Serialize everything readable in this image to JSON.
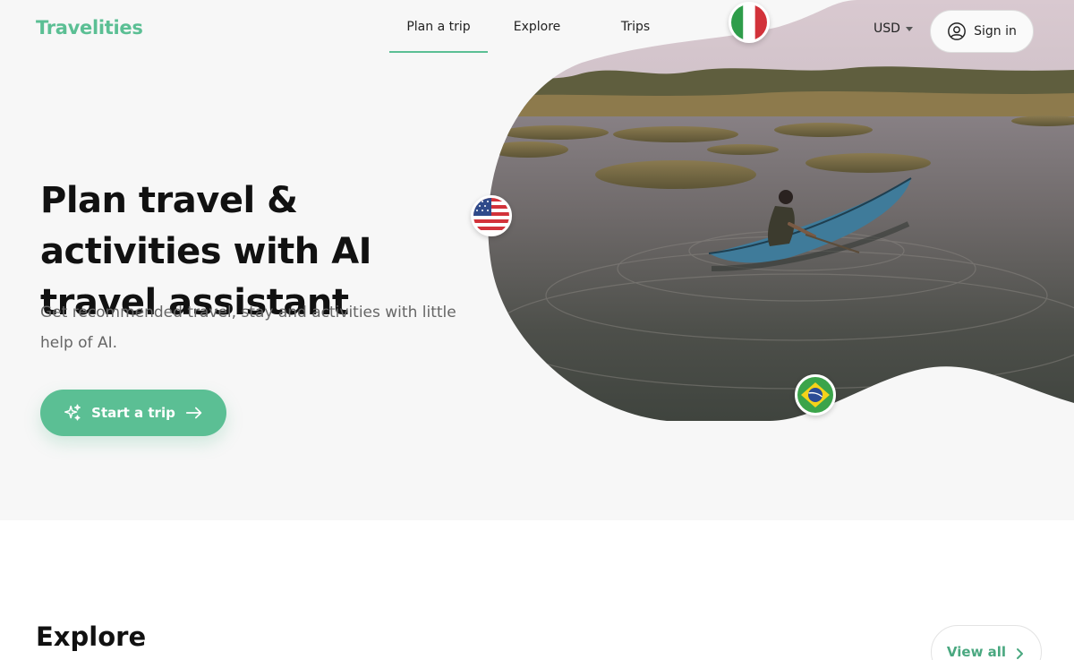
{
  "header": {
    "logo": "Travelities",
    "nav": [
      {
        "label": "Plan a trip",
        "active": true
      },
      {
        "label": "Explore",
        "active": false
      },
      {
        "label": "Trips",
        "active": false
      }
    ],
    "currency": "USD",
    "signin_label": "Sign in"
  },
  "hero": {
    "title": "Plan travel & activities with AI travel assistant",
    "subtitle": "Get recommended travel, stay and activities with little help of AI.",
    "cta_label": "Start a trip",
    "flags": [
      "italy-flag",
      "usa-flag",
      "brazil-flag"
    ]
  },
  "explore": {
    "title": "Explore",
    "view_all_label": "View all"
  },
  "colors": {
    "accent": "#5bbf94",
    "hero_bg": "#f7f7f7",
    "text": "#111111",
    "muted": "#666666"
  }
}
